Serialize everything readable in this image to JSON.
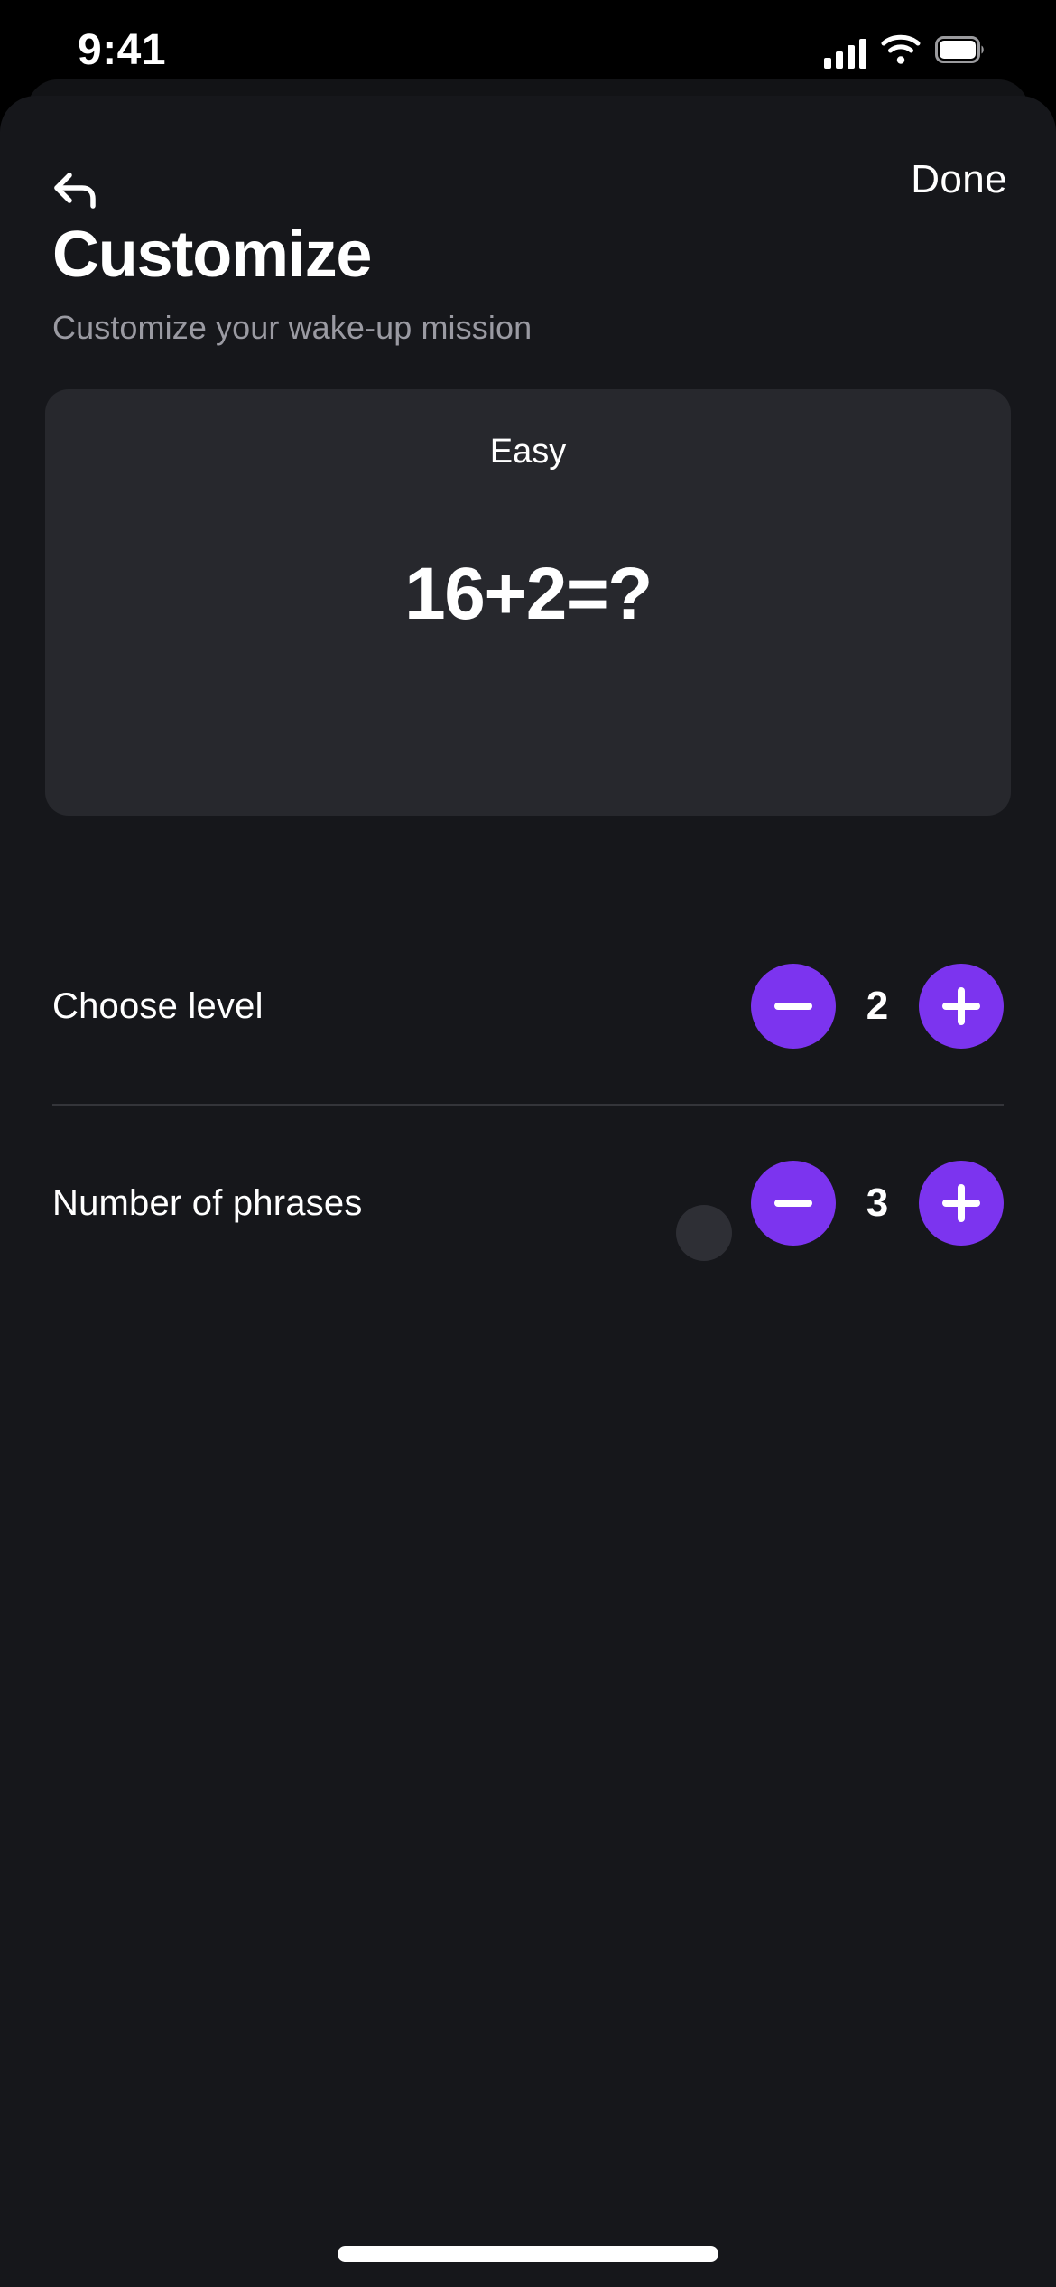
{
  "status_bar": {
    "time": "9:41",
    "icons": {
      "cellular": "cellular-signal-icon",
      "wifi": "wifi-icon",
      "battery": "battery-icon"
    }
  },
  "nav": {
    "back_icon": "back-arrow-icon",
    "done_label": "Done"
  },
  "header": {
    "title": "Customize",
    "subtitle": "Customize your wake-up mission"
  },
  "preview": {
    "difficulty": "Easy",
    "equation": "16+2=?",
    "answer_dot": "answer-placeholder-dot"
  },
  "settings": {
    "rows": [
      {
        "label": "Choose level",
        "value": "2",
        "decrement_icon": "minus-icon",
        "increment_icon": "plus-icon"
      },
      {
        "label": "Number of phrases",
        "value": "3",
        "decrement_icon": "minus-icon",
        "increment_icon": "plus-icon"
      }
    ]
  },
  "colors": {
    "accent": "#7c34ef",
    "sheet_background": "#16171b",
    "card_background": "#27282d",
    "screen_background": "#000000",
    "text_primary": "#ffffff",
    "text_secondary": "#9a9aa2",
    "divider": "#34353a"
  },
  "home_indicator": "home-indicator"
}
